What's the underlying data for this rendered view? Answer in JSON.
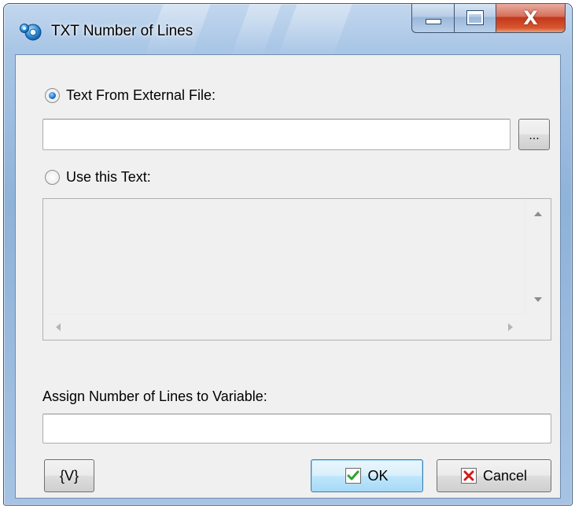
{
  "window": {
    "title": "TXT Number of Lines"
  },
  "titlebar_buttons": {
    "minimize_icon": "minimize-icon",
    "maximize_icon": "maximize-icon",
    "close_icon": "close-icon",
    "close_glyph": "X"
  },
  "source": {
    "external_file_label": "Text From External File:",
    "external_file_selected": true,
    "file_path_value": "",
    "browse_label": "...",
    "use_text_label": "Use this Text:",
    "use_text_selected": false,
    "text_value": ""
  },
  "variable": {
    "label": "Assign Number of Lines to Variable:",
    "value": ""
  },
  "buttons": {
    "variables_label": "{V}",
    "ok_label": "OK",
    "cancel_label": "Cancel"
  },
  "colors": {
    "ok_check": "#2aa52a",
    "cancel_x": "#d11a1a",
    "close_button": "#c2381b",
    "frame_glass": "#a9c6e6"
  }
}
